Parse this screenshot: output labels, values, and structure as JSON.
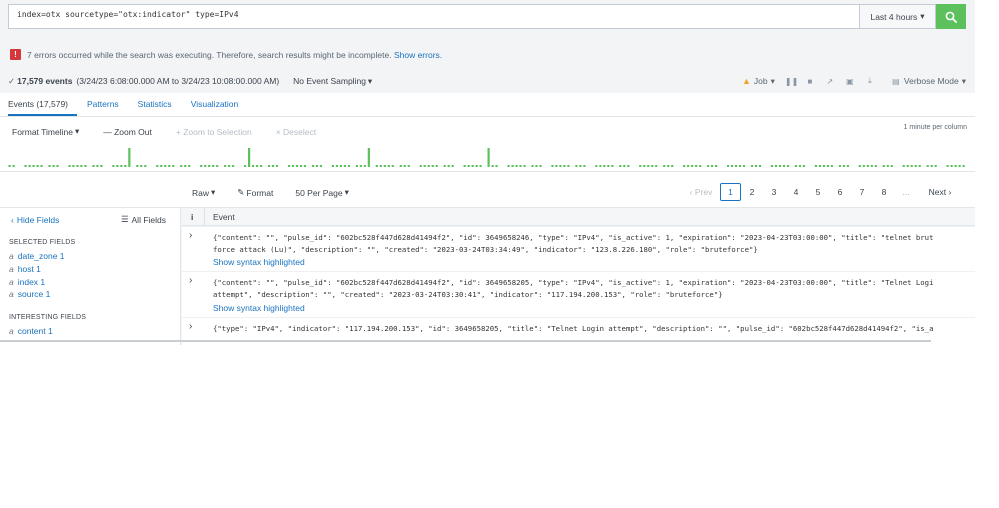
{
  "search": {
    "query": "index=otx sourcetype=\"otx:indicator\" type=IPv4",
    "time_range": "Last 4 hours",
    "time_caret": "▾"
  },
  "error": {
    "icon": "!",
    "message": "7 errors occurred while the search was executing. Therefore, search results might be incomplete.",
    "link": "Show errors."
  },
  "status": {
    "check": "✓",
    "count": "17,579 events",
    "range": "(3/24/23 6:08:00.000 AM to 3/24/23 10:08:00.000 AM)",
    "sampling": "No Event Sampling",
    "job": "Job",
    "mode": "Verbose Mode"
  },
  "tabs": [
    "Events (17,579)",
    "Patterns",
    "Statistics",
    "Visualization"
  ],
  "timeline": {
    "format": "Format Timeline",
    "zoom_out": "— Zoom Out",
    "zoom_selection": "+ Zoom to Selection",
    "deselect": "× Deselect",
    "scale": "1 minute per column",
    "spikes": [
      30,
      60,
      90,
      120
    ],
    "columns": 240
  },
  "events_bar": {
    "raw": "Raw",
    "format": "Format",
    "per_page": "50 Per Page"
  },
  "pagination": {
    "prev": "‹ Prev",
    "pages": [
      "1",
      "2",
      "3",
      "4",
      "5",
      "6",
      "7",
      "8"
    ],
    "ellipsis": "...",
    "next": "Next ›",
    "current": "1"
  },
  "sidebar": {
    "hide": "Hide Fields",
    "all": "All Fields",
    "selected_head": "SELECTED FIELDS",
    "selected": [
      {
        "type": "a",
        "name": "date_zone 1"
      },
      {
        "type": "a",
        "name": "host 1"
      },
      {
        "type": "a",
        "name": "index 1"
      },
      {
        "type": "a",
        "name": "source 1"
      }
    ],
    "interesting_head": "INTERESTING FIELDS",
    "interesting": [
      {
        "type": "a",
        "name": "content 1"
      }
    ]
  },
  "events_table": {
    "col_i": "i",
    "col_event": "Event",
    "show_syntax": "Show syntax highlighted",
    "rows": [
      {
        "line1": "{\"content\": \"\", \"pulse_id\": \"602bc528f447d628d41494f2\", \"id\": 3649658246, \"type\": \"IPv4\", \"is_active\": 1, \"expiration\": \"2023-04-23T03:00:00\", \"title\": \"telnet brut",
        "line2": "force attack (Lu)\", \"description\": \"\", \"created\": \"2023-03-24T03:34:49\", \"indicator\": \"123.8.226.180\", \"role\": \"bruteforce\"}"
      },
      {
        "line1": "{\"content\": \"\", \"pulse_id\": \"602bc528f447d628d41494f2\", \"id\": 3649658205, \"type\": \"IPv4\", \"is_active\": 1, \"expiration\": \"2023-04-23T03:00:00\", \"title\": \"Telnet Logi",
        "line2": "attempt\", \"description\": \"\", \"created\": \"2023-03-24T03:30:41\", \"indicator\": \"117.194.200.153\", \"role\": \"bruteforce\"}"
      },
      {
        "line1": "{\"type\": \"IPv4\", \"indicator\": \"117.194.200.153\", \"id\": 3649658205, \"title\": \"Telnet Login attempt\", \"description\": \"\", \"pulse_id\": \"602bc528f447d628d41494f2\", \"is_a",
        "line2": ""
      }
    ]
  },
  "colors": {
    "accent": "#1a73c0",
    "search_button": "#5cc05c",
    "error": "#d6373b",
    "warning": "#f1a32d",
    "timeline_bar": "#5cc05c"
  }
}
